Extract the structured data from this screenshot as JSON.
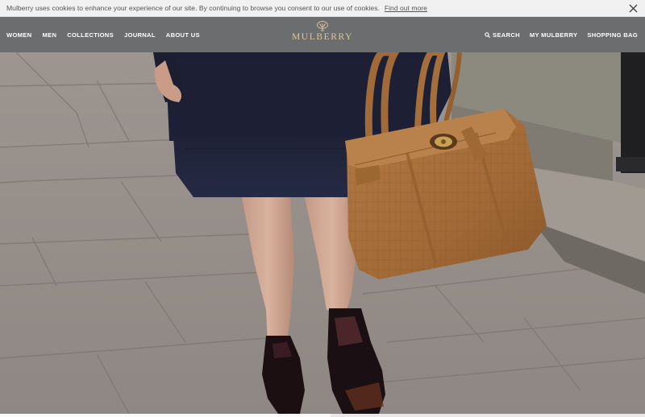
{
  "cookie_bar": {
    "text": "Mulberry uses cookies to enhance your experience of our site. By continuing to browse you consent to our use of cookies.",
    "link": "Find out more",
    "close_icon": "close-icon"
  },
  "header": {
    "nav_left": [
      {
        "label": "WOMEN"
      },
      {
        "label": "MEN"
      },
      {
        "label": "COLLECTIONS"
      },
      {
        "label": "JOURNAL"
      },
      {
        "label": "ABOUT US"
      }
    ],
    "logo": {
      "text": "MULBERRY",
      "icon": "tree-logo-icon",
      "color": "#d9c79c"
    },
    "nav_right": {
      "search": {
        "label": "SEARCH",
        "icon": "search-icon"
      },
      "account": {
        "label": "MY MULBERRY"
      },
      "bag": {
        "label": "SHOPPING BAG"
      }
    }
  },
  "hero": {
    "image": "woman-walking-with-tan-leather-handbag"
  },
  "colors": {
    "header_bg": "#6b6d6f",
    "cookie_bg": "#f1f1f1",
    "bag_tan": "#a8713e"
  }
}
